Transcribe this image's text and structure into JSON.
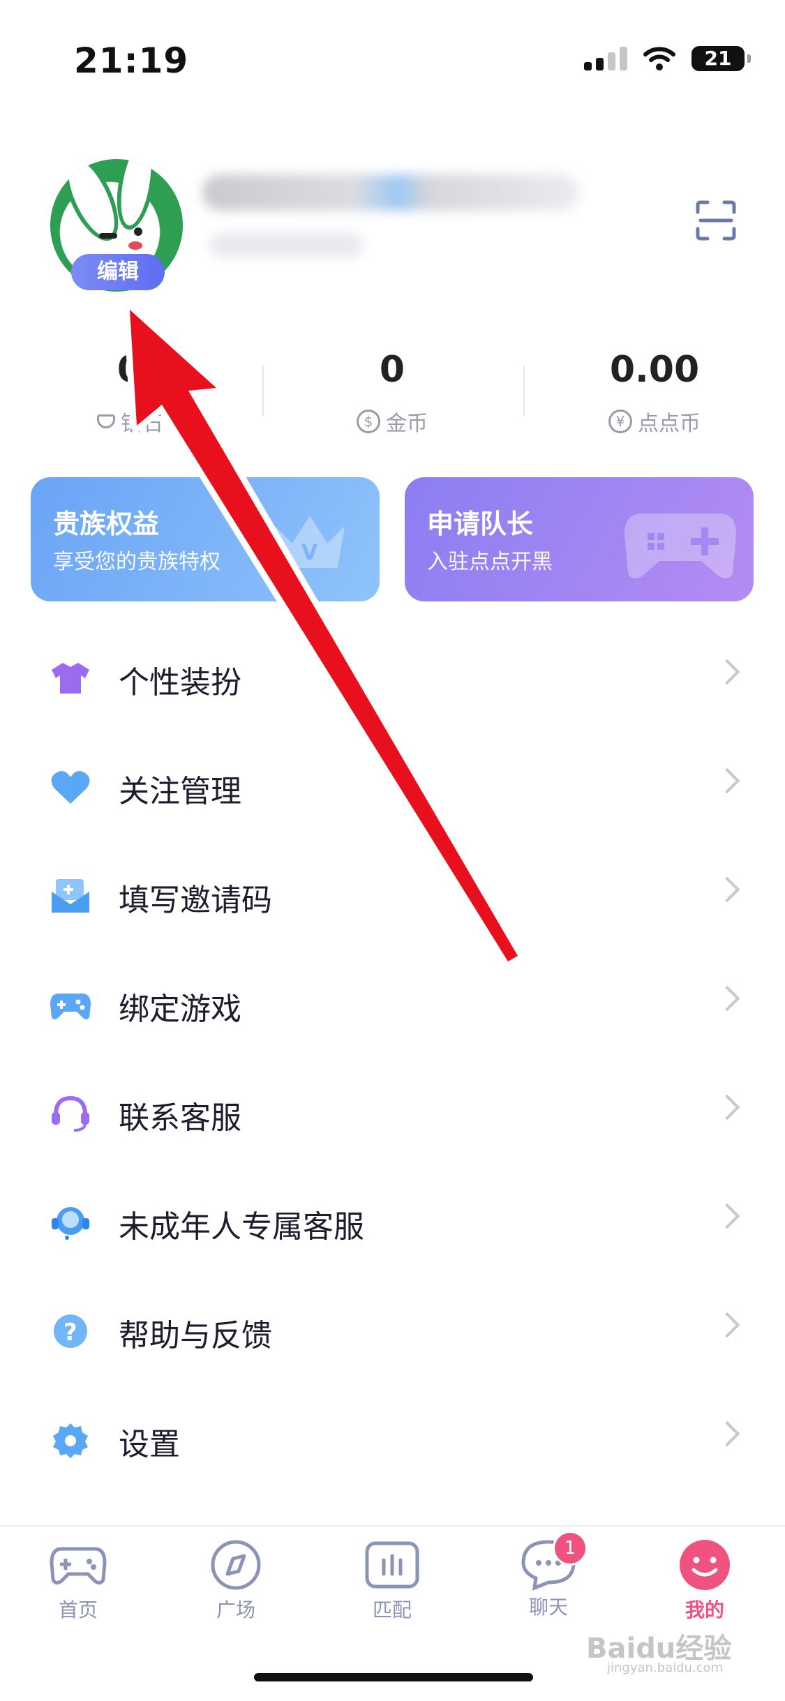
{
  "status_bar": {
    "time": "21:19",
    "battery": "21"
  },
  "profile": {
    "edit_label": "编辑"
  },
  "stats": [
    {
      "value": "0",
      "label": "钻石",
      "icon": "gem-icon"
    },
    {
      "value": "0",
      "label": "金币",
      "icon": "dollar-coin-icon",
      "symbol": "$"
    },
    {
      "value": "0.00",
      "label": "点点币",
      "icon": "yen-coin-icon",
      "symbol": "¥"
    }
  ],
  "cards": {
    "noble": {
      "title": "贵族权益",
      "subtitle": "享受您的贵族特权",
      "icon": "crown-icon"
    },
    "captain": {
      "title": "申请队长",
      "subtitle": "入驻点点开黑",
      "icon": "gamepad-icon"
    }
  },
  "menu": [
    {
      "label": "个性装扮",
      "icon": "tshirt-icon"
    },
    {
      "label": "关注管理",
      "icon": "heart-icon"
    },
    {
      "label": "填写邀请码",
      "icon": "invite-envelope-icon"
    },
    {
      "label": "绑定游戏",
      "icon": "gamepad-icon"
    },
    {
      "label": "联系客服",
      "icon": "headset-icon"
    },
    {
      "label": "未成年人专属客服",
      "icon": "support-agent-icon"
    },
    {
      "label": "帮助与反馈",
      "icon": "question-icon"
    },
    {
      "label": "设置",
      "icon": "gear-icon"
    }
  ],
  "tabs": [
    {
      "label": "首页",
      "icon": "gamepad-tab-icon"
    },
    {
      "label": "广场",
      "icon": "compass-icon"
    },
    {
      "label": "匹配",
      "icon": "match-bars-icon"
    },
    {
      "label": "聊天",
      "icon": "chat-bubble-icon",
      "badge": "1"
    },
    {
      "label": "我的",
      "icon": "smiley-icon"
    }
  ],
  "watermark": {
    "text": "Baidu经验",
    "sub": "jingyan.baidu.com"
  },
  "colors": {
    "accent": "#f0527f",
    "tab_inactive": "#8b93b8",
    "noble_card": "#6aa4f5",
    "captain_card": "#8b7ef2",
    "arrow": "#e8101c"
  }
}
